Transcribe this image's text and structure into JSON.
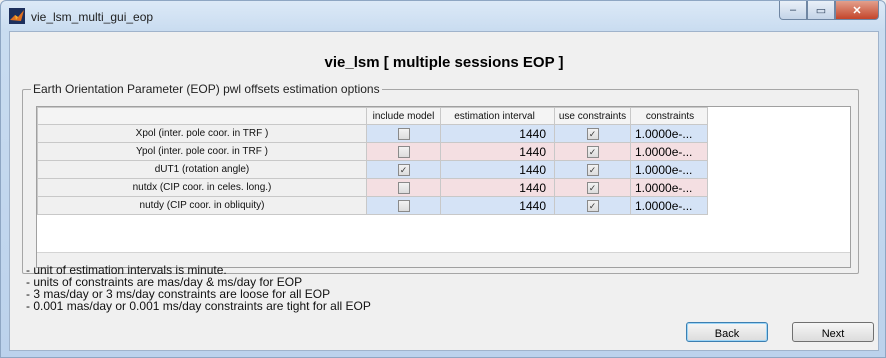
{
  "window": {
    "title": "vie_lsm_multi_gui_eop",
    "controls": {
      "minimize": "–",
      "maximize": "▭",
      "close": "✕"
    }
  },
  "heading": "vie_lsm [ multiple sessions EOP ]",
  "panel": {
    "legend": "Earth Orientation Parameter (EOP) pwl offsets estimation options",
    "columns": [
      "include model",
      "estimation interval",
      "use constraints",
      "constraints"
    ],
    "rows": [
      {
        "label": "Xpol (inter. pole coor. in TRF )",
        "include_model": false,
        "interval": "1440",
        "use_constraints": true,
        "constraints": "1.0000e-..."
      },
      {
        "label": "Ypol (inter. pole coor. in TRF )",
        "include_model": false,
        "interval": "1440",
        "use_constraints": true,
        "constraints": "1.0000e-..."
      },
      {
        "label": "dUT1 (rotation angle)",
        "include_model": true,
        "interval": "1440",
        "use_constraints": true,
        "constraints": "1.0000e-..."
      },
      {
        "label": "nutdx (CIP coor. in celes. long.)",
        "include_model": false,
        "interval": "1440",
        "use_constraints": true,
        "constraints": "1.0000e-..."
      },
      {
        "label": "nutdy (CIP coor. in obliquity)",
        "include_model": false,
        "interval": "1440",
        "use_constraints": true,
        "constraints": "1.0000e-..."
      }
    ],
    "row_colors": [
      "#d5e3f6",
      "#f4dfe2"
    ]
  },
  "notes": [
    "- unit of estimation intervals is minute.",
    "- units of constraints are mas/day & ms/day for EOP",
    "- 3 mas/day or 3 ms/day constraints are loose for all EOP",
    "- 0.001 mas/day or 0.001 ms/day constraints are tight for all EOP"
  ],
  "buttons": {
    "back": "Back",
    "next": "Next"
  },
  "checkmark": "✓"
}
